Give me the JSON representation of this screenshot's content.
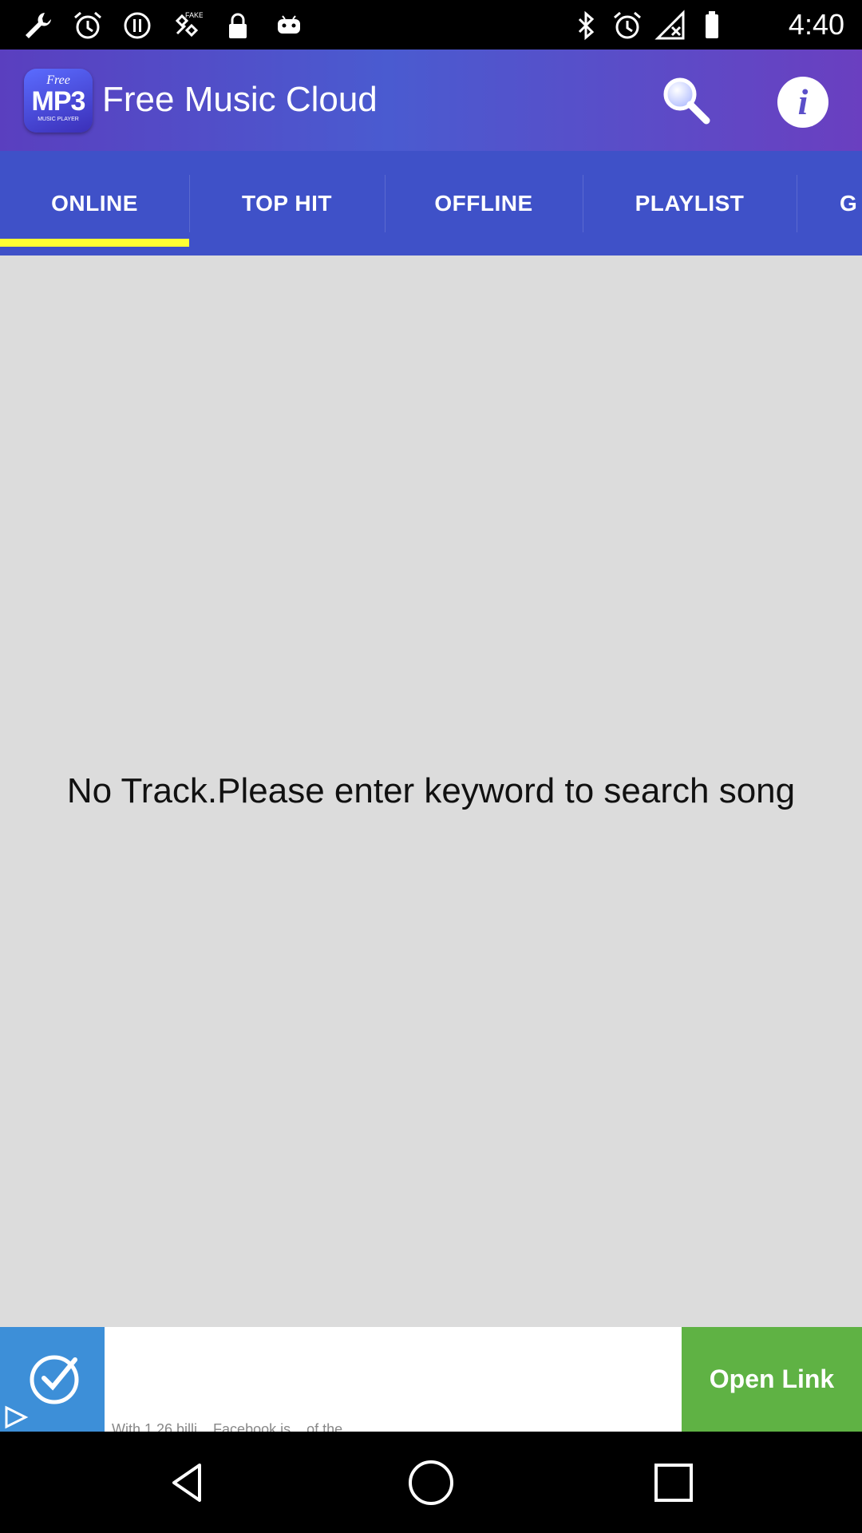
{
  "status_bar": {
    "time": "4:40",
    "left_icons": [
      "wrench-icon",
      "alarm-icon",
      "record-icon",
      "fake-gps-icon",
      "lock-icon",
      "android-icon"
    ],
    "right_icons": [
      "bluetooth-icon",
      "alarm-icon",
      "no-signal-icon",
      "battery-icon"
    ]
  },
  "app_bar": {
    "logo": {
      "line1": "Free",
      "line2": "MP3",
      "line3": "MUSIC PLAYER"
    },
    "title": "Free Music Cloud",
    "search_icon": "search-icon",
    "info_icon": "info-icon",
    "info_glyph": "i"
  },
  "tabs": [
    {
      "label": "ONLINE",
      "selected": true
    },
    {
      "label": "TOP HIT",
      "selected": false
    },
    {
      "label": "OFFLINE",
      "selected": false
    },
    {
      "label": "PLAYLIST",
      "selected": false
    },
    {
      "label": "G",
      "selected": false
    }
  ],
  "colors": {
    "tab_indicator": "#ffff33",
    "tab_bar": "#3f51c8",
    "content_bg": "#dcdcdc",
    "ad_button": "#5fb244"
  },
  "content": {
    "empty_message": "No Track.Please enter keyword to search song"
  },
  "ad": {
    "button_label": "Open Link",
    "text": "With 1.26 billi... Facebook is... of the"
  },
  "nav_bar": {
    "back_icon": "back-icon",
    "home_icon": "home-icon",
    "recents_icon": "recents-icon"
  }
}
